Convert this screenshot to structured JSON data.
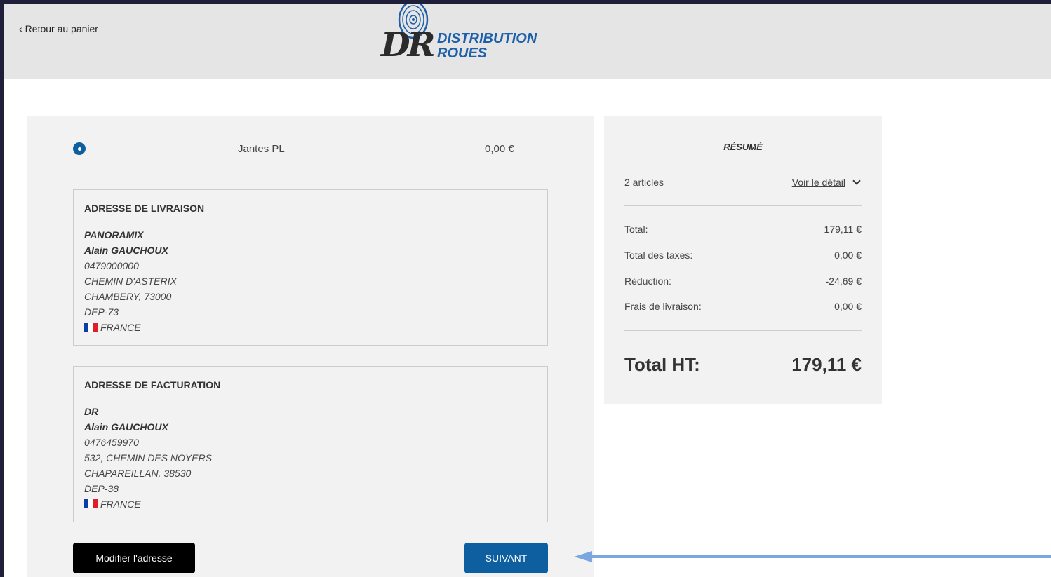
{
  "header": {
    "back_label": "Retour au panier",
    "logo": {
      "initials": "DR",
      "line1": "DISTRIBUTION",
      "line2": "ROUES",
      "brand_color": "#1d5fa8"
    }
  },
  "shipping_method": {
    "name": "Jantes PL",
    "price": "0,00 €"
  },
  "shipping_address": {
    "title": "ADRESSE DE LIVRAISON",
    "company": "PANORAMIX",
    "name": "Alain GAUCHOUX",
    "phone": "0479000000",
    "street": "CHEMIN D'ASTERIX",
    "city": "CHAMBERY, 73000",
    "region": "DEP-73",
    "country": "FRANCE"
  },
  "billing_address": {
    "title": "ADRESSE DE FACTURATION",
    "company": "DR",
    "name": "Alain GAUCHOUX",
    "phone": "0476459970",
    "street": "532, CHEMIN DES NOYERS",
    "city": "CHAPAREILLAN, 38530",
    "region": "DEP-38",
    "country": "FRANCE"
  },
  "buttons": {
    "modify": "Modifier l'adresse",
    "next": "SUIVANT"
  },
  "summary": {
    "title": "RÉSUMÉ",
    "articles": "2 articles",
    "detail_link": "Voir le détail",
    "total_label": "Total:",
    "total_value": "179,11 €",
    "taxes_label": "Total des taxes:",
    "taxes_value": "0,00 €",
    "discount_label": "Réduction:",
    "discount_value": "-24,69 €",
    "shipping_label": "Frais de livraison:",
    "shipping_value": "0,00 €",
    "total_ht_label": "Total HT:",
    "total_ht_value": "179,11 €"
  },
  "colors": {
    "primary": "#0d5fa0",
    "arrow": "#7aa7e0"
  }
}
